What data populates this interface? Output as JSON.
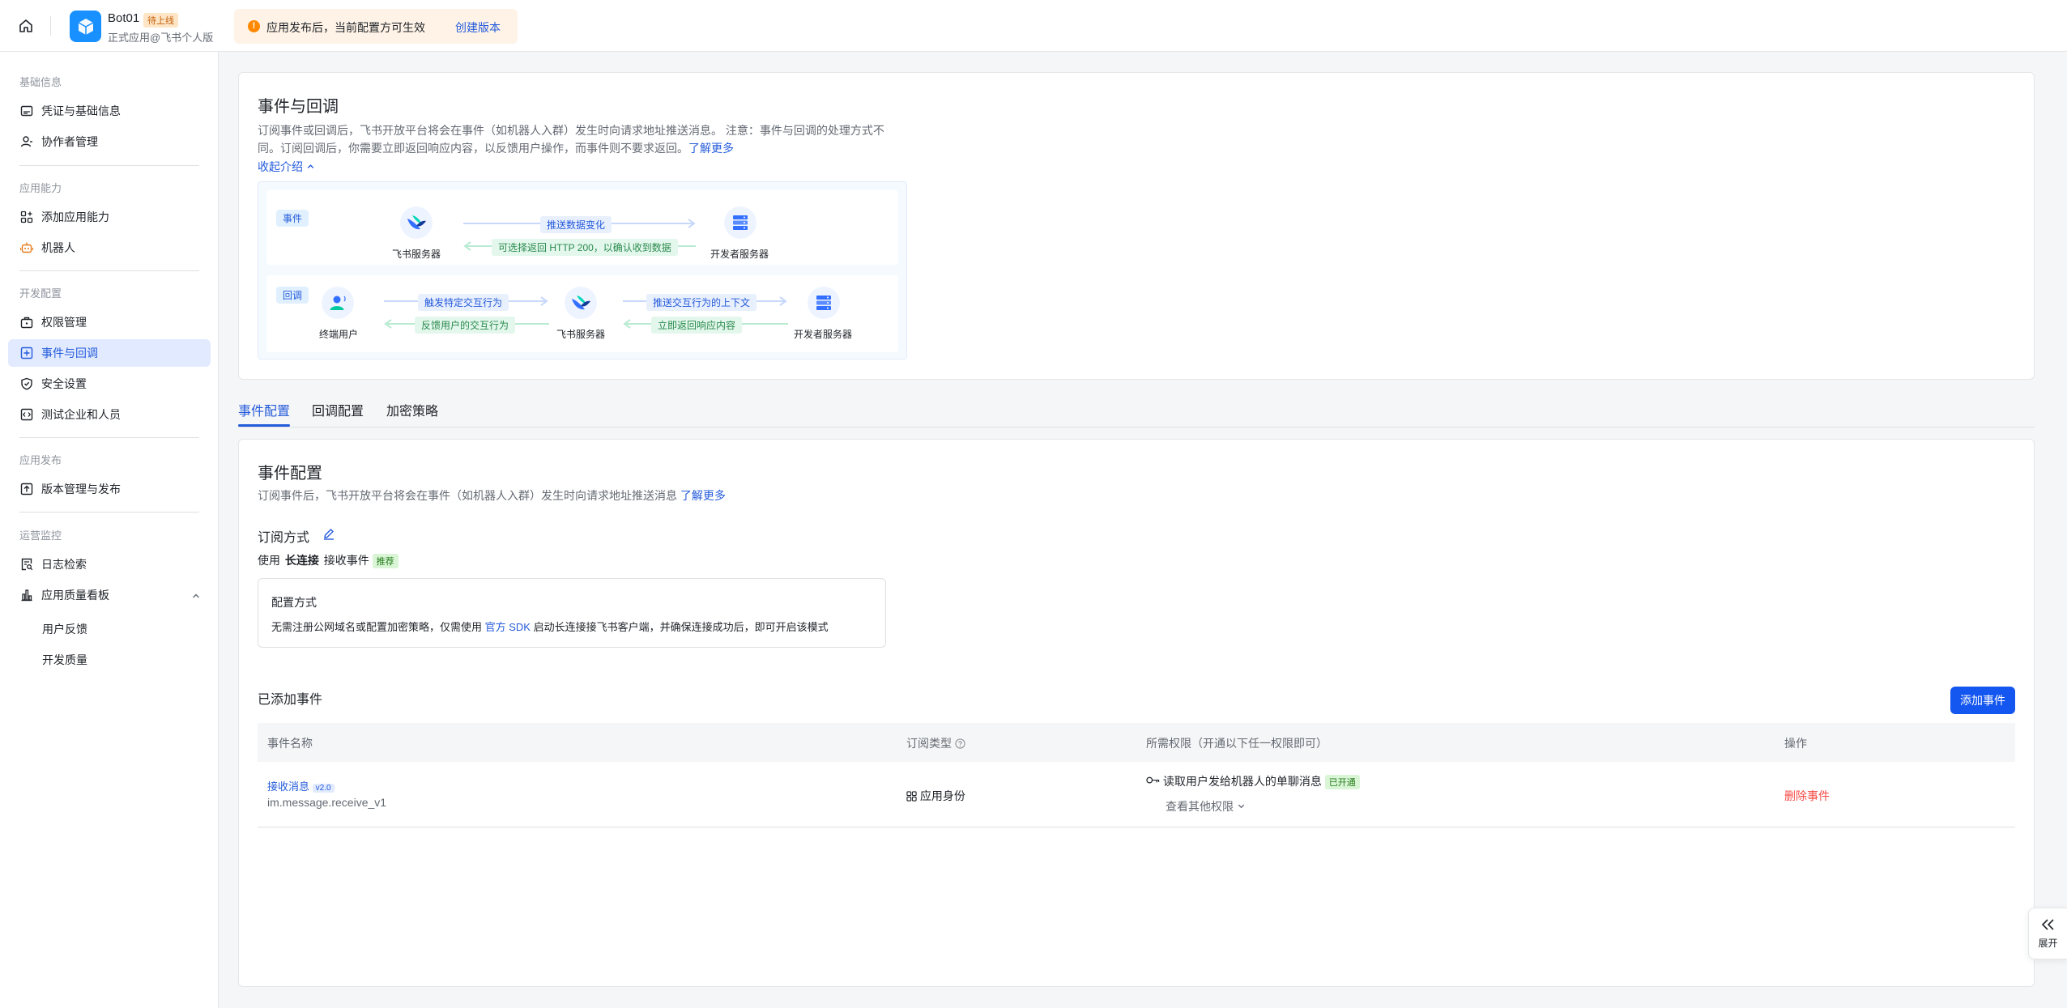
{
  "header": {
    "app_name": "Bot01",
    "app_status": "待上线",
    "app_sub": "正式应用@飞书个人版",
    "notice_text": "应用发布后，当前配置方可生效",
    "notice_link": "创建版本"
  },
  "sidebar": {
    "group_basic": "基础信息",
    "item_credentials": "凭证与基础信息",
    "item_collaborators": "协作者管理",
    "group_capability": "应用能力",
    "item_add_capability": "添加应用能力",
    "item_bot": "机器人",
    "group_dev": "开发配置",
    "item_permissions": "权限管理",
    "item_events": "事件与回调",
    "item_security": "安全设置",
    "item_test": "测试企业和人员",
    "group_release": "应用发布",
    "item_versions": "版本管理与发布",
    "group_ops": "运营监控",
    "item_logs": "日志检索",
    "item_quality": "应用质量看板",
    "sub_feedback": "用户反馈",
    "sub_dev_quality": "开发质量"
  },
  "intro": {
    "title": "事件与回调",
    "desc_line1": "订阅事件或回调后，飞书开放平台将会在事件（如机器人入群）发生时向请求地址推送消息。 注意：事件与回调的处理方式不",
    "desc_line2": "同。订阅回调后，你需要立即返回响应内容，以反馈用户操作，而事件则不要求返回。",
    "learn_more": "了解更多",
    "collapse": "收起介绍",
    "event_tag": "事件",
    "callback_tag": "回调",
    "feishu_server": "飞书服务器",
    "dev_server": "开发者服务器",
    "end_user": "终端用户",
    "event_push": "推送数据变化",
    "event_return": "可选择返回 HTTP 200，以确认收到数据",
    "cb_trigger": "触发特定交互行为",
    "cb_feedback": "反馈用户的交互行为",
    "cb_push_context": "推送交互行为的上下文",
    "cb_return_now": "立即返回响应内容"
  },
  "tabs": [
    "事件配置",
    "回调配置",
    "加密策略"
  ],
  "event_config": {
    "title": "事件配置",
    "desc": "订阅事件后，飞书开放平台将会在事件（如机器人入群）发生时向请求地址推送消息",
    "learn_more": "了解更多",
    "sub_mode_label": "订阅方式",
    "use_prefix": "使用",
    "mode": "长连接",
    "use_suffix": "接收事件",
    "recommend": "推荐",
    "cfg_title": "配置方式",
    "cfg_desc_a": "无需注册公网域名或配置加密策略，仅需使用",
    "cfg_sdk": "官方 SDK",
    "cfg_desc_b": "启动长连接接飞书客户端，并确保连接成功后，即可开启该模式",
    "added_title": "已添加事件",
    "add_button": "添加事件"
  },
  "table": {
    "headers": [
      "事件名称",
      "订阅类型",
      "所需权限（开通以下任一权限即可）",
      "操作"
    ],
    "rows": [
      {
        "name": "接收消息",
        "version": "v2.0",
        "key": "im.message.receive_v1",
        "type": "应用身份",
        "permission": "读取用户发给机器人的单聊消息",
        "perm_status": "已开通",
        "more_perms": "查看其他权限",
        "action": "删除事件"
      }
    ]
  },
  "expand_label": "展开"
}
